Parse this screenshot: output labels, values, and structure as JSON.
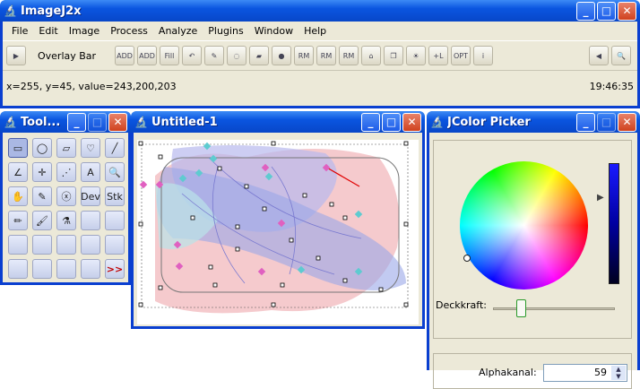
{
  "main": {
    "title": "ImageJ2x",
    "menu": [
      "File",
      "Edit",
      "Image",
      "Process",
      "Analyze",
      "Plugins",
      "Window",
      "Help"
    ],
    "overlay_label": "Overlay Bar",
    "toolbar_buttons": [
      "ADD",
      "ADD",
      "Fill",
      "",
      "",
      "",
      "",
      "",
      "RM",
      "RM",
      "RM",
      "",
      "",
      "",
      "",
      "",
      "OPT",
      ""
    ],
    "status": "x=255, y=45, value=243,200,203",
    "clock": "19:46:35"
  },
  "tools": {
    "title": "Tool...",
    "items": [
      "▭",
      "◯",
      "▱",
      "♡",
      "╱",
      "∠",
      "✛",
      "⋰",
      "A",
      "🔍",
      "✋",
      "✎",
      "ⓧ",
      "Dev",
      "Stk",
      "✏",
      "🖌",
      "⚗",
      "",
      "",
      "",
      "",
      "",
      "",
      "",
      "",
      "",
      "",
      "",
      ">>"
    ]
  },
  "image_window": {
    "title": "Untitled-1"
  },
  "picker": {
    "title": "JColor Picker",
    "opacity_label": "Deckkraft:",
    "alpha_label": "Alphakanal:",
    "alpha_value": "59"
  }
}
